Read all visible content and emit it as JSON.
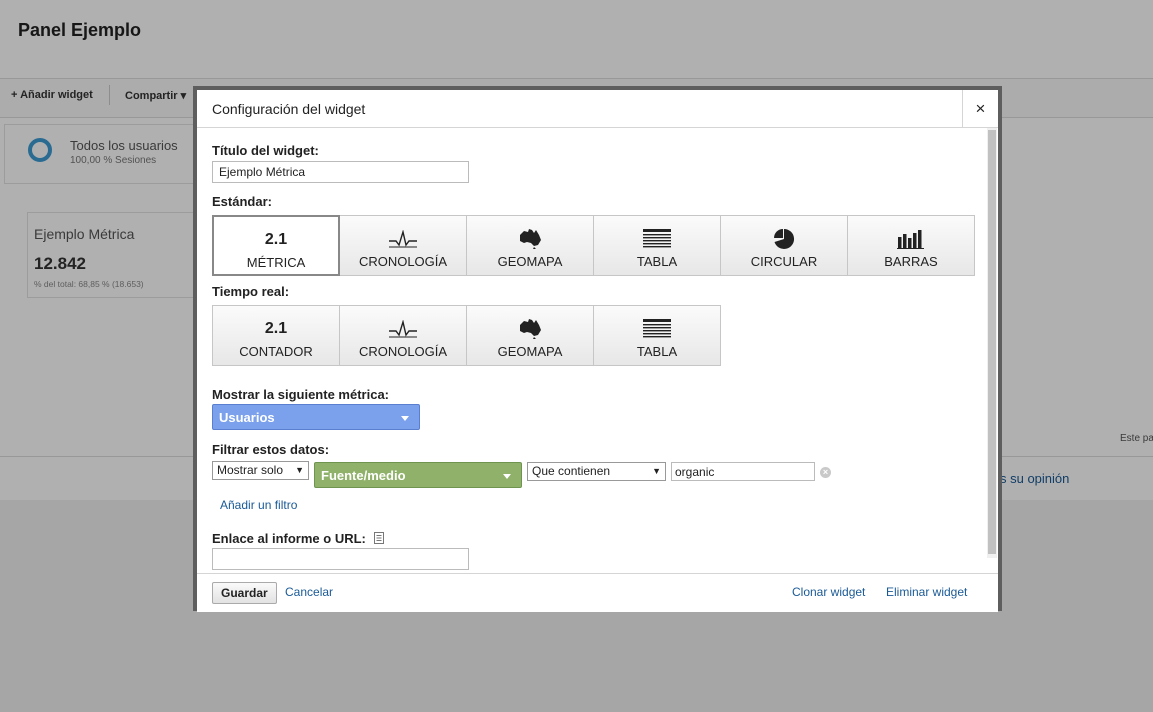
{
  "page": {
    "title": "Panel Ejemplo",
    "toolbar": {
      "add_widget": "+ Añadir widget",
      "share": "Compartir",
      "share_caret": "▾"
    },
    "segment": {
      "name": "Todos los usuarios",
      "sub": "100,00 % Sesiones"
    },
    "card": {
      "title": "Ejemplo Métrica",
      "value": "12.842",
      "sub": "% del total: 68,85 % (18.653)"
    },
    "side_note": "Este pa",
    "opinion_link": "s su opinión"
  },
  "dialog": {
    "title": "Configuración del widget",
    "close": "×",
    "widget_title_label": "Título del widget:",
    "widget_title_value": "Ejemplo Métrica",
    "standard_label": "Estándar:",
    "standard_options": [
      {
        "label": "MÉTRICA",
        "icon": "2.1",
        "icon_name": "metric-icon",
        "selected": true
      },
      {
        "label": "CRONOLOGÍA",
        "icon_name": "timeline-icon",
        "selected": false
      },
      {
        "label": "GEOMAPA",
        "icon_name": "geomap-icon",
        "selected": false
      },
      {
        "label": "TABLA",
        "icon_name": "table-icon",
        "selected": false
      },
      {
        "label": "CIRCULAR",
        "icon_name": "pie-icon",
        "selected": false
      },
      {
        "label": "BARRAS",
        "icon_name": "bar-chart-icon",
        "selected": false
      }
    ],
    "realtime_label": "Tiempo real:",
    "realtime_options": [
      {
        "label": "CONTADOR",
        "icon": "2.1",
        "icon_name": "counter-icon"
      },
      {
        "label": "CRONOLOGÍA",
        "icon_name": "timeline-icon"
      },
      {
        "label": "GEOMAPA",
        "icon_name": "geomap-icon"
      },
      {
        "label": "TABLA",
        "icon_name": "table-icon"
      }
    ],
    "metric_label": "Mostrar la siguiente métrica:",
    "metric_value": "Usuarios",
    "filter_label": "Filtrar estos datos:",
    "filter_mode": "Mostrar solo",
    "filter_dimension": "Fuente/medio",
    "filter_condition": "Que contienen",
    "filter_value": "organic",
    "add_filter": "Añadir un filtro",
    "link_label": "Enlace al informe o URL:",
    "link_value": "",
    "save": "Guardar",
    "cancel": "Cancelar",
    "clone": "Clonar widget",
    "delete": "Eliminar widget"
  },
  "colors": {
    "metric_select": "#7ba1ec",
    "dimension_select": "#8fb16a",
    "link": "#1a5a96",
    "segment_ring": "#3d9bd4"
  }
}
